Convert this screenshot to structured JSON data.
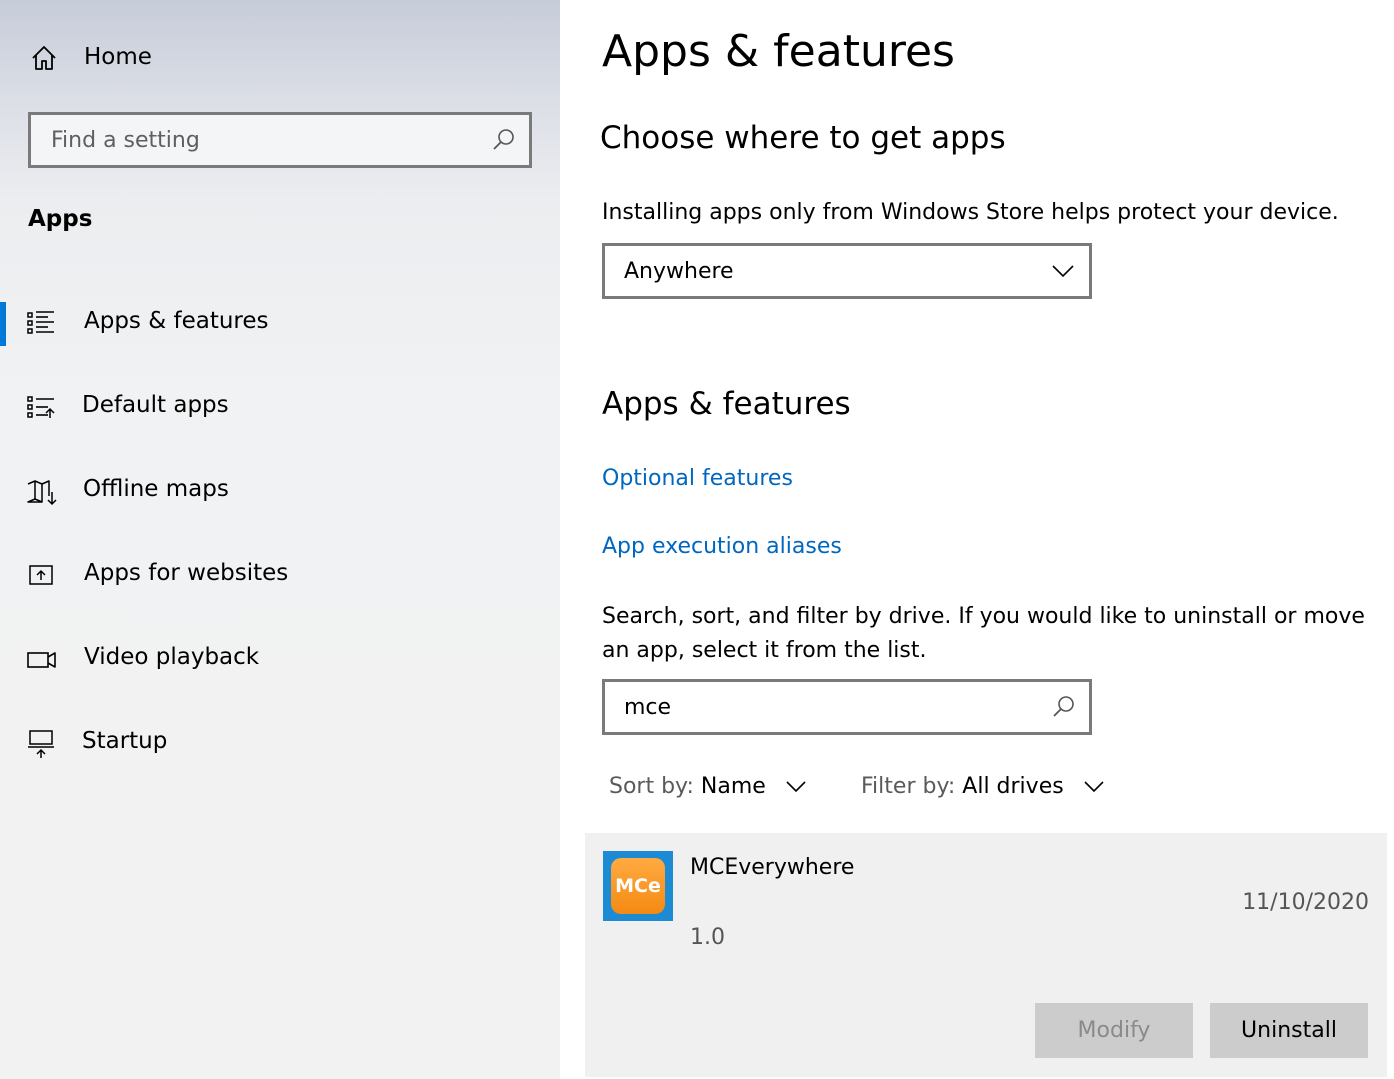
{
  "sidebar": {
    "home_label": "Home",
    "search_placeholder": "Find a setting",
    "section_title": "Apps",
    "items": [
      {
        "label": "Apps & features",
        "icon": "apps-features-icon",
        "selected": true
      },
      {
        "label": "Default apps",
        "icon": "default-apps-icon",
        "selected": false
      },
      {
        "label": "Offline maps",
        "icon": "offline-maps-icon",
        "selected": false
      },
      {
        "label": "Apps for websites",
        "icon": "apps-for-websites-icon",
        "selected": false
      },
      {
        "label": "Video playback",
        "icon": "video-playback-icon",
        "selected": false
      },
      {
        "label": "Startup",
        "icon": "startup-icon",
        "selected": false
      }
    ]
  },
  "main": {
    "title": "Apps & features",
    "choose_heading": "Choose where to get apps",
    "choose_description": "Installing apps only from Windows Store helps protect your device.",
    "source_dropdown_value": "Anywhere",
    "features_heading": "Apps & features",
    "optional_features_link": "Optional features",
    "app_execution_aliases_link": "App execution aliases",
    "list_description": "Search, sort, and filter by drive. If you would like to uninstall or move an app, select it from the list.",
    "app_search_value": "mce",
    "sort_label": "Sort by:",
    "sort_value": "Name",
    "filter_label": "Filter by:",
    "filter_value": "All drives",
    "app": {
      "icon_text": "MCe",
      "name": "MCEverywhere",
      "version": "1.0",
      "date": "11/10/2020",
      "modify_label": "Modify",
      "uninstall_label": "Uninstall"
    }
  },
  "colors": {
    "accent": "#0078d7",
    "link": "#0067c0",
    "app_icon_bg": "#1c8bd4",
    "app_icon_orange": "#f58a12"
  }
}
